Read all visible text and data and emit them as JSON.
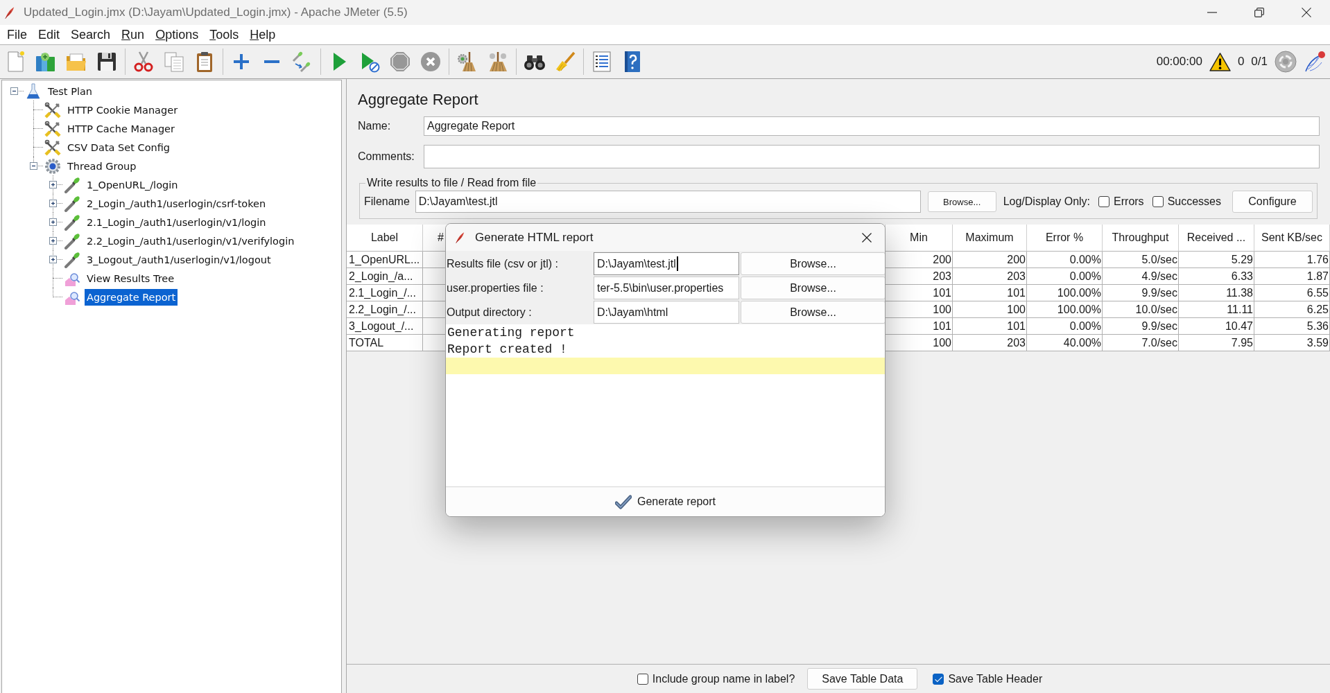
{
  "window": {
    "title": "Updated_Login.jmx (D:\\Jayam\\Updated_Login.jmx) - Apache JMeter (5.5)"
  },
  "menu": [
    {
      "label": "File",
      "mnemonic": false
    },
    {
      "label": "Edit",
      "mnemonic": false
    },
    {
      "label": "Search",
      "mnemonic": false
    },
    {
      "label": "Run",
      "mnemonic": true
    },
    {
      "label": "Options",
      "mnemonic": true
    },
    {
      "label": "Tools",
      "mnemonic": true
    },
    {
      "label": "Help",
      "mnemonic": true
    }
  ],
  "toolbar": {
    "groups": [
      {
        "buttons": [
          {
            "kind": "new",
            "disabled": false
          },
          {
            "kind": "templates",
            "disabled": false
          },
          {
            "kind": "open",
            "disabled": false
          },
          {
            "kind": "save",
            "disabled": false
          }
        ]
      },
      {
        "buttons": [
          {
            "kind": "cut",
            "disabled": false
          },
          {
            "kind": "copy",
            "disabled": false
          },
          {
            "kind": "paste",
            "disabled": false
          }
        ]
      },
      {
        "buttons": [
          {
            "kind": "expand",
            "disabled": false
          },
          {
            "kind": "collapse",
            "disabled": false
          },
          {
            "kind": "toggle",
            "disabled": false
          }
        ]
      },
      {
        "buttons": [
          {
            "kind": "start",
            "disabled": false
          },
          {
            "kind": "startnopause",
            "disabled": false
          },
          {
            "kind": "stop",
            "disabled": true
          },
          {
            "kind": "shutdown",
            "disabled": true
          }
        ]
      },
      {
        "buttons": [
          {
            "kind": "clear",
            "disabled": false
          },
          {
            "kind": "clearall",
            "disabled": false
          }
        ]
      },
      {
        "buttons": [
          {
            "kind": "search",
            "disabled": false
          },
          {
            "kind": "reset",
            "disabled": false
          }
        ]
      },
      {
        "buttons": [
          {
            "kind": "functions",
            "disabled": false
          },
          {
            "kind": "help",
            "disabled": false
          }
        ]
      }
    ],
    "elapsed_time": "00:00:00",
    "warning_count": "0",
    "active_threads": "0/1"
  },
  "tree": [
    {
      "label": "Test Plan",
      "kind": "testplan",
      "selected": false,
      "expanded": true,
      "children": [
        {
          "label": "HTTP Cookie Manager",
          "kind": "config",
          "selected": false
        },
        {
          "label": "HTTP Cache Manager",
          "kind": "config",
          "selected": false
        },
        {
          "label": "CSV Data Set Config",
          "kind": "config",
          "selected": false
        },
        {
          "label": "Thread Group",
          "kind": "threadgroup",
          "selected": false,
          "expanded": true,
          "children": [
            {
              "label": "1_OpenURL_/login",
              "kind": "sampler",
              "selected": false,
              "expanded": false
            },
            {
              "label": "2_Login_/auth1/userlogin/csrf-token",
              "kind": "sampler",
              "selected": false,
              "expanded": false
            },
            {
              "label": "2.1_Login_/auth1/userlogin/v1/login",
              "kind": "sampler",
              "selected": false,
              "expanded": false
            },
            {
              "label": "2.2_Login_/auth1/userlogin/v1/verifylogin",
              "kind": "sampler",
              "selected": false,
              "expanded": false
            },
            {
              "label": "3_Logout_/auth1/userlogin/v1/logout",
              "kind": "sampler",
              "selected": false,
              "expanded": false
            },
            {
              "label": "View Results Tree",
              "kind": "listener",
              "selected": false
            },
            {
              "label": "Aggregate Report",
              "kind": "listener",
              "selected": true
            }
          ]
        }
      ]
    }
  ],
  "editor": {
    "title": "Aggregate Report",
    "name": {
      "label": "Name:",
      "value": "Aggregate Report"
    },
    "comments": {
      "label": "Comments:"
    },
    "file_group": {
      "title": "Write results to file / Read from file",
      "filename_label": "Filename",
      "filename": "D:\\Jayam\\test.jtl",
      "browse": "Browse...",
      "log_display_label": "Log/Display Only:",
      "options": [
        {
          "label": "Errors",
          "checked": false
        },
        {
          "label": "Successes",
          "checked": false
        }
      ],
      "configure": "Configure"
    }
  },
  "table": {
    "columns": [
      "Label",
      "#",
      "Min",
      "Maximum",
      "Error %",
      "Throughput",
      "Received ...",
      "Sent KB/sec"
    ],
    "rows": [
      {
        "label": "1_OpenURL...",
        "values": [
          "200",
          "200",
          "0.00%",
          "5.0/sec",
          "5.29",
          "1.76"
        ]
      },
      {
        "label": "2_Login_/a...",
        "values": [
          "203",
          "203",
          "0.00%",
          "4.9/sec",
          "6.33",
          "1.87"
        ]
      },
      {
        "label": "2.1_Login_/...",
        "values": [
          "101",
          "101",
          "100.00%",
          "9.9/sec",
          "11.38",
          "6.55"
        ]
      },
      {
        "label": "2.2_Login_/...",
        "values": [
          "100",
          "100",
          "100.00%",
          "10.0/sec",
          "11.11",
          "6.25"
        ]
      },
      {
        "label": "3_Logout_/...",
        "values": [
          "101",
          "101",
          "0.00%",
          "9.9/sec",
          "10.47",
          "5.36"
        ]
      },
      {
        "label": "TOTAL",
        "values": [
          "100",
          "203",
          "40.00%",
          "7.0/sec",
          "7.95",
          "3.59"
        ]
      }
    ]
  },
  "bottom_bar": {
    "controls": [
      {
        "kind": "checkbox",
        "label": "Include group name in label?",
        "checked": false
      },
      {
        "kind": "button",
        "label": "Save Table Data"
      },
      {
        "kind": "checkbox",
        "label": "Save Table Header",
        "checked": true
      }
    ]
  },
  "dialog": {
    "title": "Generate HTML report",
    "fields": [
      {
        "label": "Results file (csv or jtl) :",
        "value": "D:\\Jayam\\test.jtl",
        "focused": true,
        "button": "Browse..."
      },
      {
        "label": "user.properties file :",
        "value": "ter-5.5\\bin\\user.properties",
        "focused": false,
        "button": "Browse..."
      },
      {
        "label": "Output directory :",
        "value": "D:\\Jayam\\html",
        "focused": false,
        "button": "Browse..."
      }
    ],
    "log_lines": [
      "Generating report",
      "Report created !"
    ],
    "generate_button": "Generate report"
  }
}
